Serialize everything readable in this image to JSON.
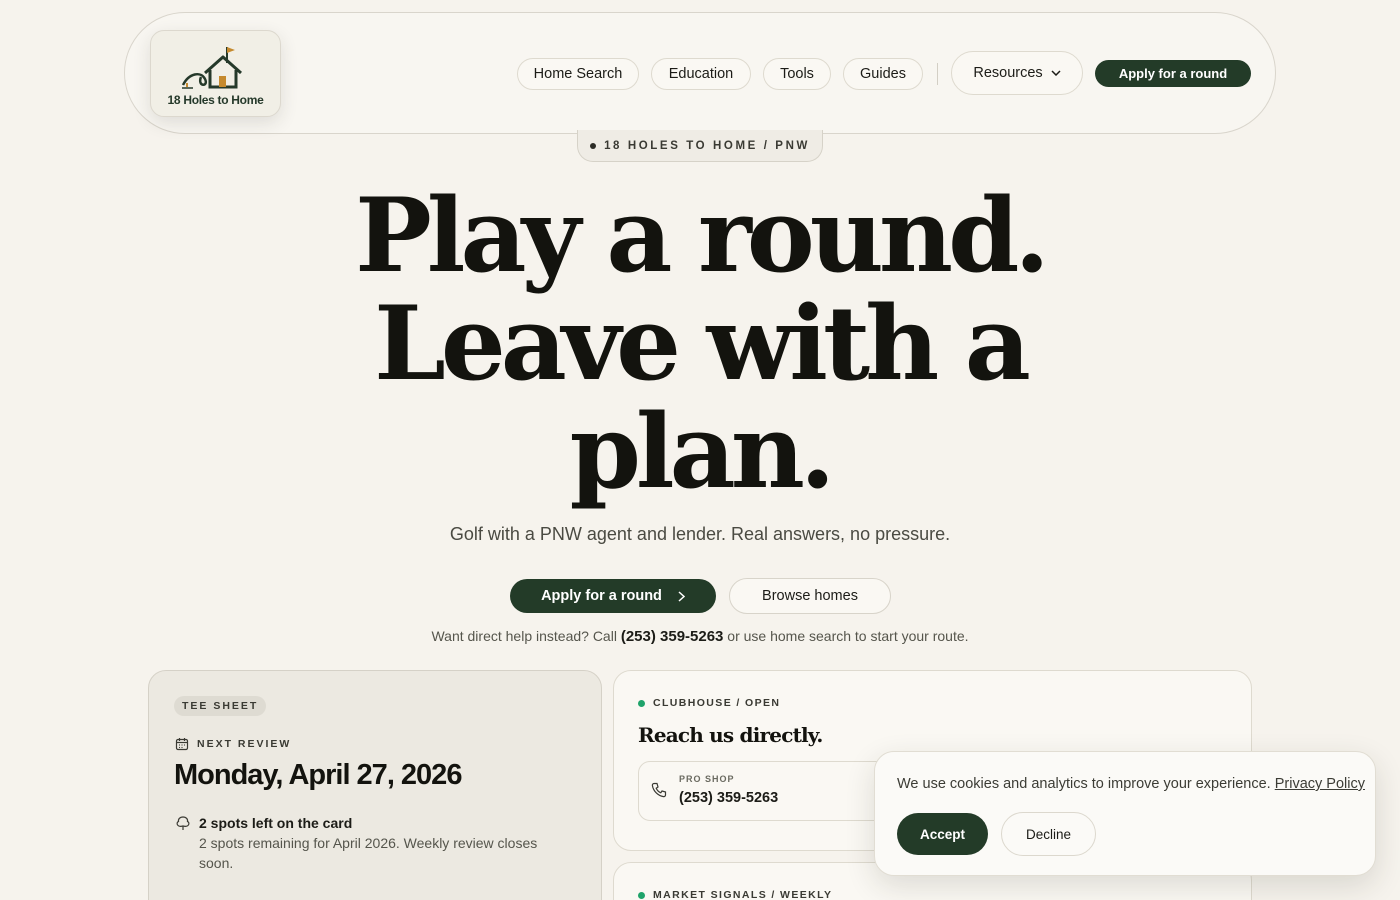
{
  "brand": {
    "logo_text": "18 Holes to Home"
  },
  "nav": {
    "items": [
      "Home Search",
      "Education",
      "Tools",
      "Guides"
    ],
    "resources": "Resources",
    "cta": "Apply for a round"
  },
  "eyebrow": "18 HOLES TO HOME / PNW",
  "hero": {
    "line1": "Play a round.",
    "line2": "Leave with a",
    "line3": "plan.",
    "subtitle": "Golf with a PNW agent and lender. Real answers, no pressure.",
    "primary_cta": "Apply for a round",
    "secondary_cta": "Browse homes",
    "help_prefix": "Want direct help instead? Call ",
    "help_phone": "(253) 359-5263",
    "help_suffix": " or use home search to start your route."
  },
  "tee_sheet": {
    "tag": "TEE SHEET",
    "label": "NEXT REVIEW",
    "date": "Monday, April 27, 2026",
    "spots_title": "2 spots left on the card",
    "spots_desc": "2 spots remaining for April 2026. Weekly review closes soon."
  },
  "clubhouse": {
    "status": "CLUBHOUSE / OPEN",
    "heading": "Reach us directly.",
    "pro_shop_label": "PRO SHOP",
    "pro_shop_phone": "(253) 359-5263"
  },
  "market": {
    "status": "MARKET SIGNALS / WEEKLY"
  },
  "cookie": {
    "text": "We use cookies and analytics to improve your experience. ",
    "link": "Privacy Policy",
    "accept": "Accept",
    "decline": "Decline"
  },
  "colors": {
    "accent": "#233b28",
    "background": "#f6f3ed",
    "status_green": "#1fa36a"
  }
}
